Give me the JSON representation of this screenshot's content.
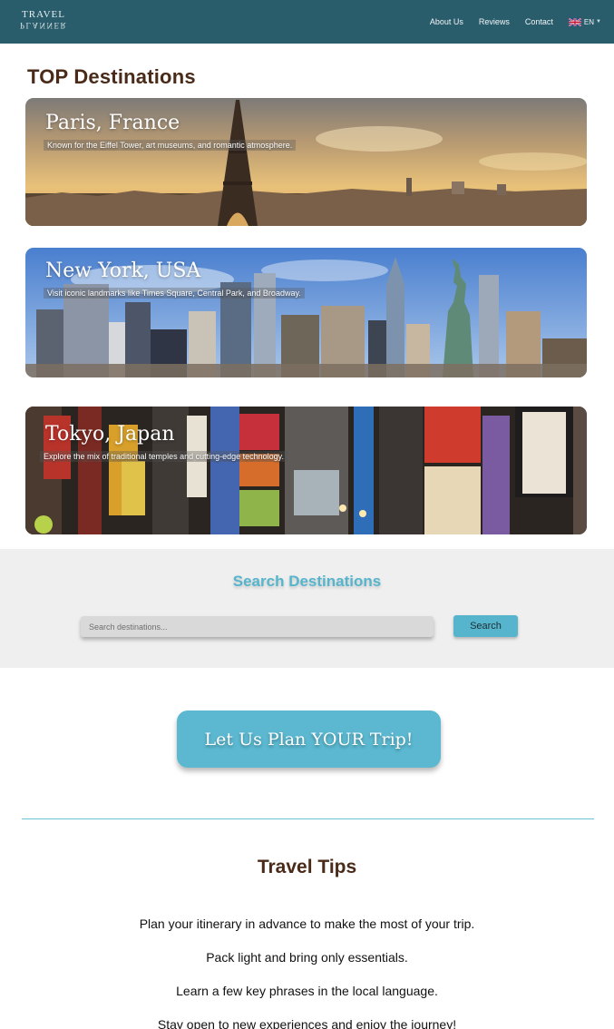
{
  "header": {
    "logo_top": "TRAVEL",
    "logo_bottom": "PLANNER",
    "nav": [
      "About Us",
      "Reviews",
      "Contact"
    ],
    "language": "EN"
  },
  "top_destinations": {
    "title": "TOP Destinations",
    "cards": [
      {
        "title": "Paris, France",
        "description": "Known for the Eiffel Tower, art museums, and romantic atmosphere."
      },
      {
        "title": "New York, USA",
        "description": "Visit iconic landmarks like Times Square, Central Park, and Broadway."
      },
      {
        "title": "Tokyo, Japan",
        "description": "Explore the mix of traditional temples and cutting-edge technology."
      }
    ]
  },
  "search": {
    "title": "Search Destinations",
    "placeholder": "Search destinations...",
    "button": "Search"
  },
  "cta": {
    "label": "Let Us Plan YOUR Trip!"
  },
  "tips": {
    "title": "Travel Tips",
    "items": [
      "Plan your itinerary in advance to make the most of your trip.",
      "Pack light and bring only essentials.",
      "Learn a few key phrases in the local language.",
      "Stay open to new experiences and enjoy the journey!"
    ]
  },
  "colors": {
    "header_bg": "#2a5d6c",
    "accent": "#56b5cc",
    "heading_brown": "#4a2a18",
    "search_band": "#efefef"
  }
}
